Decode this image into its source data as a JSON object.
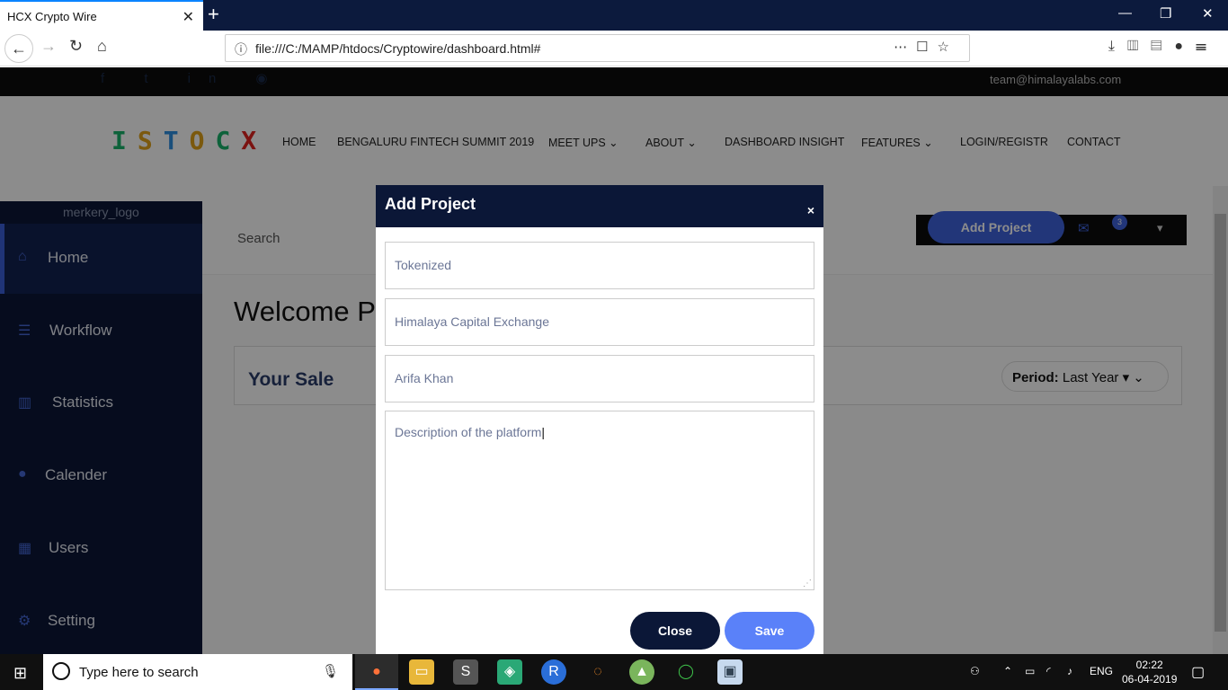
{
  "browser": {
    "tab_title": "HCX Crypto Wire",
    "url": "file:///C:/MAMP/htdocs/Cryptowire/dashboard.html#"
  },
  "site": {
    "email": "team@himalayalabs.com",
    "logo_text": "ISTOCX",
    "nav": [
      "HOME",
      "BENGALURU FINTECH SUMMIT 2019",
      "MEET UPS",
      "ABOUT",
      "DASHBOARD INSIGHT",
      "FEATURES",
      "LOGIN/REGISTR",
      "CONTACT"
    ]
  },
  "sidebar": {
    "logo_alt": "merkery_logo",
    "items": [
      {
        "label": "Home",
        "icon": "home-icon"
      },
      {
        "label": "Workflow",
        "icon": "server-icon"
      },
      {
        "label": "Statistics",
        "icon": "bar-chart-icon"
      },
      {
        "label": "Calender",
        "icon": "user-icon"
      },
      {
        "label": "Users",
        "icon": "calendar-icon"
      },
      {
        "label": "Setting",
        "icon": "gear-icon"
      }
    ]
  },
  "dashboard": {
    "search_label": "Search",
    "add_project_label": "Add Project",
    "notification_count": "3",
    "welcome_text": "Welcome Pr",
    "sale_title": "Your Sale",
    "period_label": "Period:",
    "period_value": "Last Year"
  },
  "modal": {
    "title": "Add Project",
    "close_x": "×",
    "field1": "Tokenized",
    "field2": "Himalaya Capital Exchange",
    "field3": "Arifa Khan",
    "description": "Description of the platform",
    "close_button": "Close",
    "save_button": "Save"
  },
  "taskbar": {
    "search_placeholder": "Type here to search",
    "lang": "ENG",
    "time": "02:22",
    "date": "06-04-2019"
  }
}
